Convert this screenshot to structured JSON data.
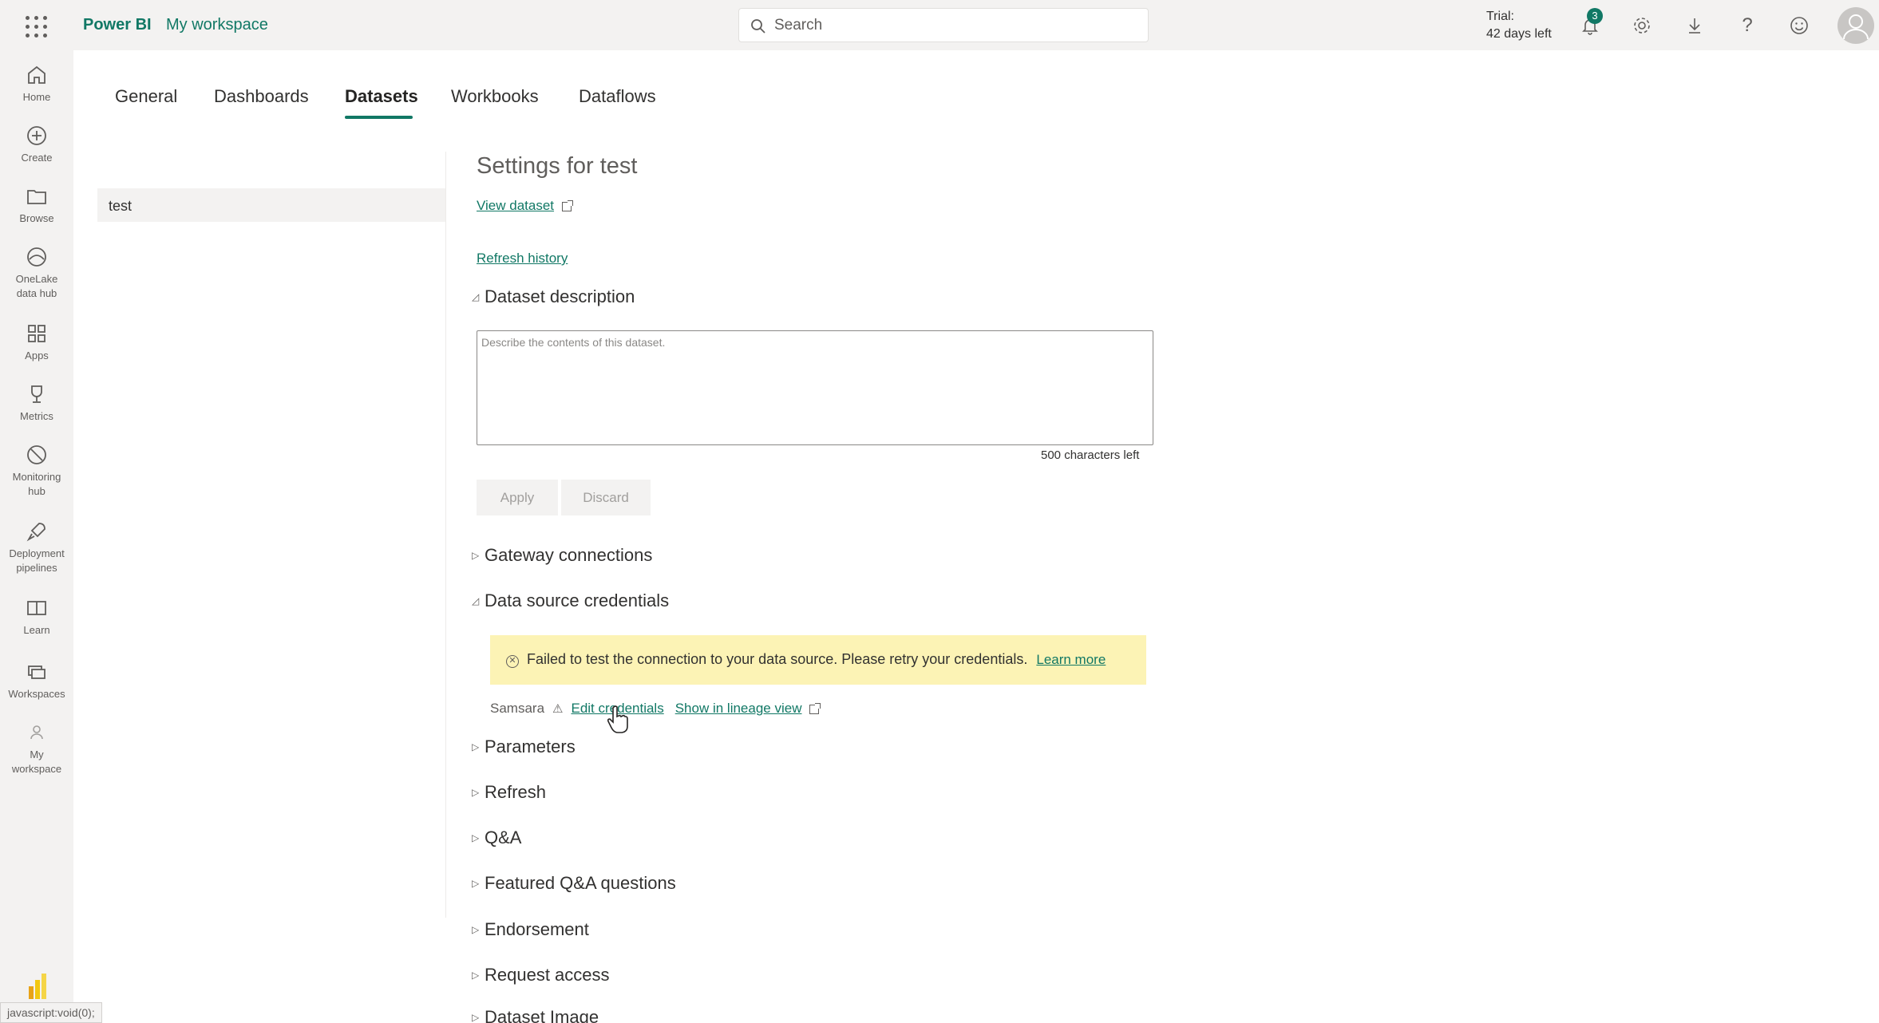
{
  "topbar": {
    "brand": "Power BI",
    "workspace": "My workspace",
    "search_placeholder": "Search",
    "trial_line1": "Trial:",
    "trial_line2": "42 days left",
    "notification_count": "3"
  },
  "leftnav": {
    "items": [
      {
        "label": "Home",
        "icon": "home-icon"
      },
      {
        "label": "Create",
        "icon": "plus-circle-icon"
      },
      {
        "label": "Browse",
        "icon": "folder-icon"
      },
      {
        "label": "OneLake data hub",
        "icon": "onelake-icon"
      },
      {
        "label": "Apps",
        "icon": "apps-icon"
      },
      {
        "label": "Metrics",
        "icon": "trophy-icon"
      },
      {
        "label": "Monitoring hub",
        "icon": "monitoring-icon"
      },
      {
        "label": "Deployment pipelines",
        "icon": "rocket-icon"
      },
      {
        "label": "Learn",
        "icon": "book-icon"
      },
      {
        "label": "Workspaces",
        "icon": "workspaces-icon"
      },
      {
        "label": "My workspace",
        "icon": "person-icon"
      }
    ]
  },
  "tabs": [
    "General",
    "Dashboards",
    "Datasets",
    "Workbooks",
    "Dataflows"
  ],
  "active_tab": "Datasets",
  "dataset_list": [
    "test"
  ],
  "settings": {
    "title": "Settings for test",
    "view_dataset": "View dataset",
    "refresh_history": "Refresh history",
    "description_heading": "Dataset description",
    "description_placeholder": "Describe the contents of this dataset.",
    "chars_left": "500 characters left",
    "apply": "Apply",
    "discard": "Discard",
    "gateway": "Gateway connections",
    "credentials_heading": "Data source credentials",
    "warning_text": "Failed to test the connection to your data source. Please retry your credentials.",
    "learn_more": "Learn more",
    "source_name": "Samsara",
    "edit_credentials": "Edit credentials",
    "lineage": "Show in lineage view",
    "parameters": "Parameters",
    "refresh": "Refresh",
    "qa": "Q&A",
    "featured_qa": "Featured Q&A questions",
    "endorsement": "Endorsement",
    "request_access": "Request access",
    "dataset_image": "Dataset Image"
  },
  "statusbar": "javascript:void(0);"
}
